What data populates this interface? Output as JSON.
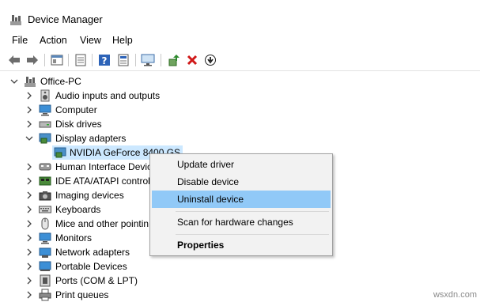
{
  "window": {
    "title": "Device Manager"
  },
  "menu": {
    "file": "File",
    "action": "Action",
    "view": "View",
    "help": "Help"
  },
  "toolbar_icons": [
    "back-arrow",
    "forward-arrow",
    "show-hide-tree",
    "properties",
    "help",
    "monitor",
    "update-driver",
    "uninstall",
    "enable-device"
  ],
  "tree": {
    "root": "Office-PC",
    "items": [
      {
        "label": "Audio inputs and outputs",
        "expanded": false
      },
      {
        "label": "Computer",
        "expanded": false
      },
      {
        "label": "Disk drives",
        "expanded": false
      },
      {
        "label": "Display adapters",
        "expanded": true
      },
      {
        "label": "NVIDIA GeForce 8400 GS",
        "child": true,
        "selected": true
      },
      {
        "label": "Human Interface Devic",
        "expanded": false
      },
      {
        "label": "IDE ATA/ATAPI control",
        "expanded": false
      },
      {
        "label": "Imaging devices",
        "expanded": false
      },
      {
        "label": "Keyboards",
        "expanded": false
      },
      {
        "label": "Mice and other pointin",
        "expanded": false
      },
      {
        "label": "Monitors",
        "expanded": false
      },
      {
        "label": "Network adapters",
        "expanded": false
      },
      {
        "label": "Portable Devices",
        "expanded": false
      },
      {
        "label": "Ports (COM & LPT)",
        "expanded": false
      },
      {
        "label": "Print queues",
        "expanded": false
      }
    ]
  },
  "context_menu": {
    "update_driver": "Update driver",
    "disable_device": "Disable device",
    "uninstall_device": "Uninstall device",
    "scan": "Scan for hardware changes",
    "properties": "Properties",
    "highlighted": "Uninstall device"
  },
  "colors": {
    "selection": "#cce8ff",
    "menu_highlight": "#91c9f7",
    "uninstall_red": "#d01818",
    "accent_green": "#2e8b2e"
  },
  "watermark": "wsxdn.com"
}
